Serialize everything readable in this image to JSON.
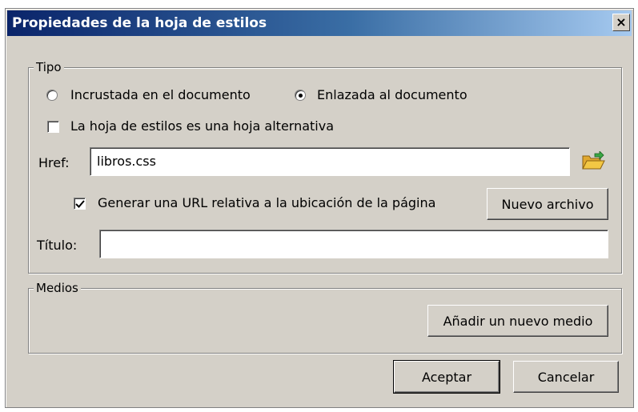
{
  "window": {
    "title": "Propiedades de la hoja de estilos",
    "close_glyph": "×"
  },
  "tipo": {
    "legend": "Tipo",
    "radio_embedded": {
      "label": "Incrustada en el documento",
      "selected": false
    },
    "radio_linked": {
      "label": "Enlazada al documento",
      "selected": true
    },
    "alternate_checkbox": {
      "label": "La hoja de estilos es una hoja alternativa",
      "checked": false
    },
    "href_label": "Href:",
    "href_value": "libros.css",
    "browse_icon": "folder-open-icon",
    "relative_url_checkbox": {
      "label": "Generar una URL relativa a la ubicación de la página",
      "checked": true
    },
    "new_file_button": "Nuevo archivo",
    "title_label": "Título:",
    "title_value": ""
  },
  "medios": {
    "legend": "Medios",
    "add_media_button": "Añadir un nuevo medio"
  },
  "footer": {
    "ok_button": "Aceptar",
    "cancel_button": "Cancelar"
  },
  "colors": {
    "dialog_bg": "#d4d0c8",
    "title_start": "#0a246a",
    "title_end": "#a6caf0",
    "folder": "#f2c744"
  }
}
